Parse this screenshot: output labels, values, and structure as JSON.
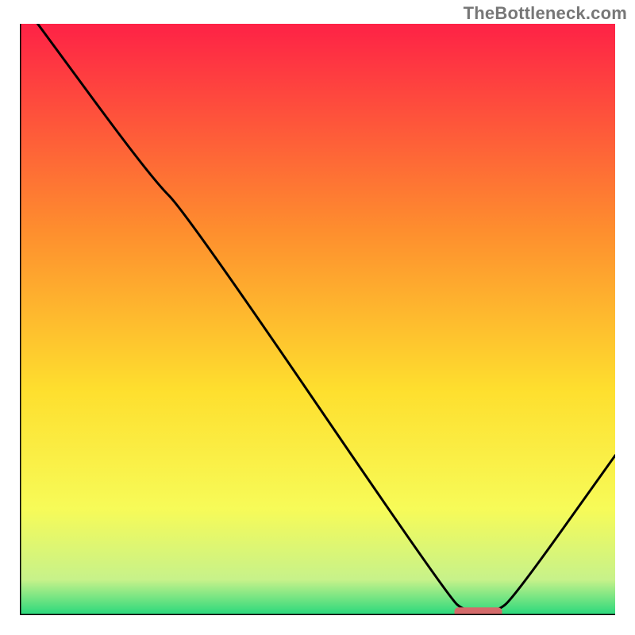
{
  "watermark": "TheBottleneck.com",
  "colors": {
    "gradient_top": "#fe2246",
    "gradient_upper_mid": "#fe8e2e",
    "gradient_mid": "#fedf2e",
    "gradient_lower": "#f7fb58",
    "gradient_low2": "#c7f28a",
    "gradient_bottom": "#27d87c",
    "curve": "#000000",
    "axes": "#000000",
    "marker": "#d46a6a"
  },
  "chart_data": {
    "type": "line",
    "title": "",
    "xlabel": "",
    "ylabel": "",
    "xlim": [
      0,
      100
    ],
    "ylim": [
      0,
      100
    ],
    "curve": [
      {
        "x": 3,
        "y": 100
      },
      {
        "x": 22,
        "y": 74
      },
      {
        "x": 28,
        "y": 68
      },
      {
        "x": 72,
        "y": 3
      },
      {
        "x": 75,
        "y": 0.5
      },
      {
        "x": 80,
        "y": 0.5
      },
      {
        "x": 83,
        "y": 3
      },
      {
        "x": 100,
        "y": 27
      }
    ],
    "optimum_marker": {
      "x_start": 73,
      "x_end": 81,
      "y": 0.5
    },
    "annotations": []
  }
}
